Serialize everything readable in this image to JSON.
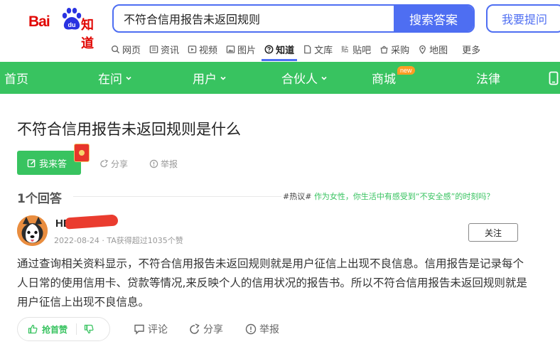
{
  "logo": {
    "text_left": "Bai",
    "text_paw": "du",
    "text_right": "知道"
  },
  "search": {
    "query": "不符合信用报告未返回规则",
    "button_label": "搜索答案"
  },
  "ask_button_label": "我要提问",
  "subnav": [
    {
      "label": "网页",
      "icon": "search-icon"
    },
    {
      "label": "资讯",
      "icon": "news-icon"
    },
    {
      "label": "视频",
      "icon": "video-icon"
    },
    {
      "label": "图片",
      "icon": "image-icon"
    },
    {
      "label": "知道",
      "icon": "question-icon",
      "active": true
    },
    {
      "label": "文库",
      "icon": "document-icon"
    },
    {
      "label": "贴吧",
      "icon": "tieba-icon"
    },
    {
      "label": "采购",
      "icon": "shopping-icon"
    },
    {
      "label": "地图",
      "icon": "map-icon"
    },
    {
      "label": "更多",
      "icon": ""
    }
  ],
  "greennav": {
    "home": "首页",
    "zaiwen": "在问",
    "users": "用户",
    "partner": "合伙人",
    "mall": "商城",
    "mall_badge": "new",
    "law": "法律"
  },
  "question": {
    "title": "不符合信用报告未返回规则是什么",
    "answer_button": "我来答",
    "share": "分享",
    "report": "举报"
  },
  "answers": {
    "count_label": "1个回答",
    "hot_tag": "#热议#",
    "hot_topic": "作为女性，你生活中有感受到“不安全感”的时刻吗？"
  },
  "answer": {
    "author": "HE",
    "meta": "2022-08-24 · TA获得超过1035个赞",
    "follow": "关注",
    "content": "通过查询相关资料显示，不符合信用报告未返回规则就是用户征信上出现不良信息。信用报告是记录每个人日常的使用信用卡、贷款等情况,来反映个人的信用状况的报告书。所以不符合信用报告未返回规则就是用户征信上出现不良信息。",
    "upvote": "抢首赞",
    "comment": "评论",
    "share": "分享",
    "report": "举报"
  },
  "colors": {
    "brand_blue": "#4e6ef2",
    "brand_green": "#38c360",
    "logo_red": "#e10602"
  }
}
